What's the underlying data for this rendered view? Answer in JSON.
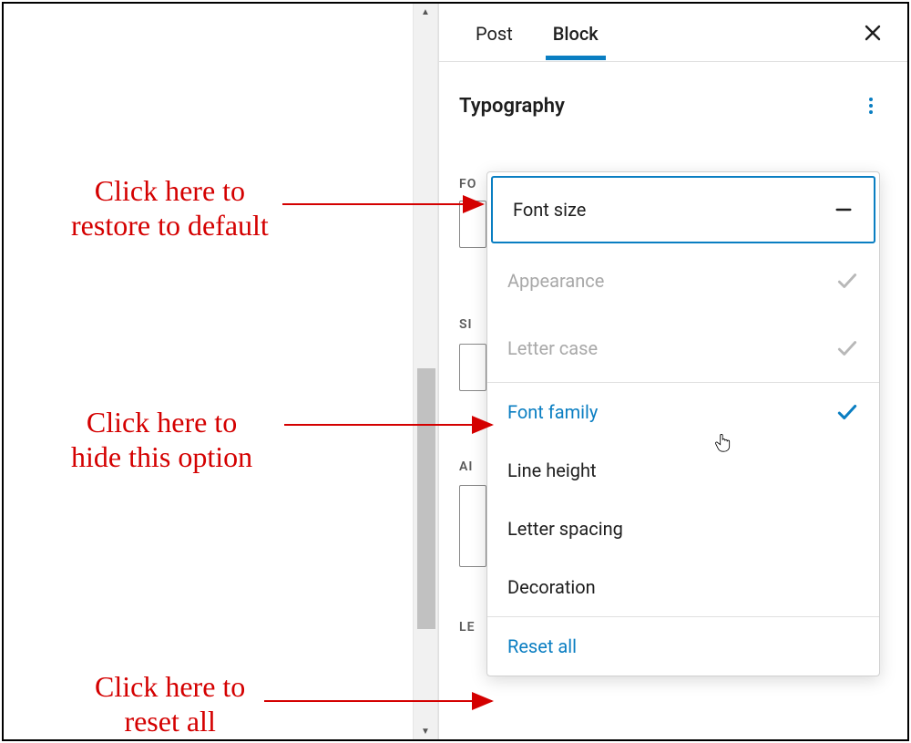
{
  "tabs": {
    "post": "Post",
    "block": "Block"
  },
  "panel": {
    "title": "Typography"
  },
  "truncated_labels": {
    "font": "FO",
    "size": "SI",
    "appear": "AI",
    "letter": "LE"
  },
  "menu": {
    "font_size": "Font size",
    "appearance": "Appearance",
    "letter_case": "Letter case",
    "font_family": "Font family",
    "line_height": "Line height",
    "letter_spacing": "Letter spacing",
    "decoration": "Decoration",
    "reset_all": "Reset all"
  },
  "annotations": {
    "restore": "Click here to\nrestore to default",
    "hide": "Click here to\nhide this option",
    "reset": "Click here to\nreset all"
  }
}
